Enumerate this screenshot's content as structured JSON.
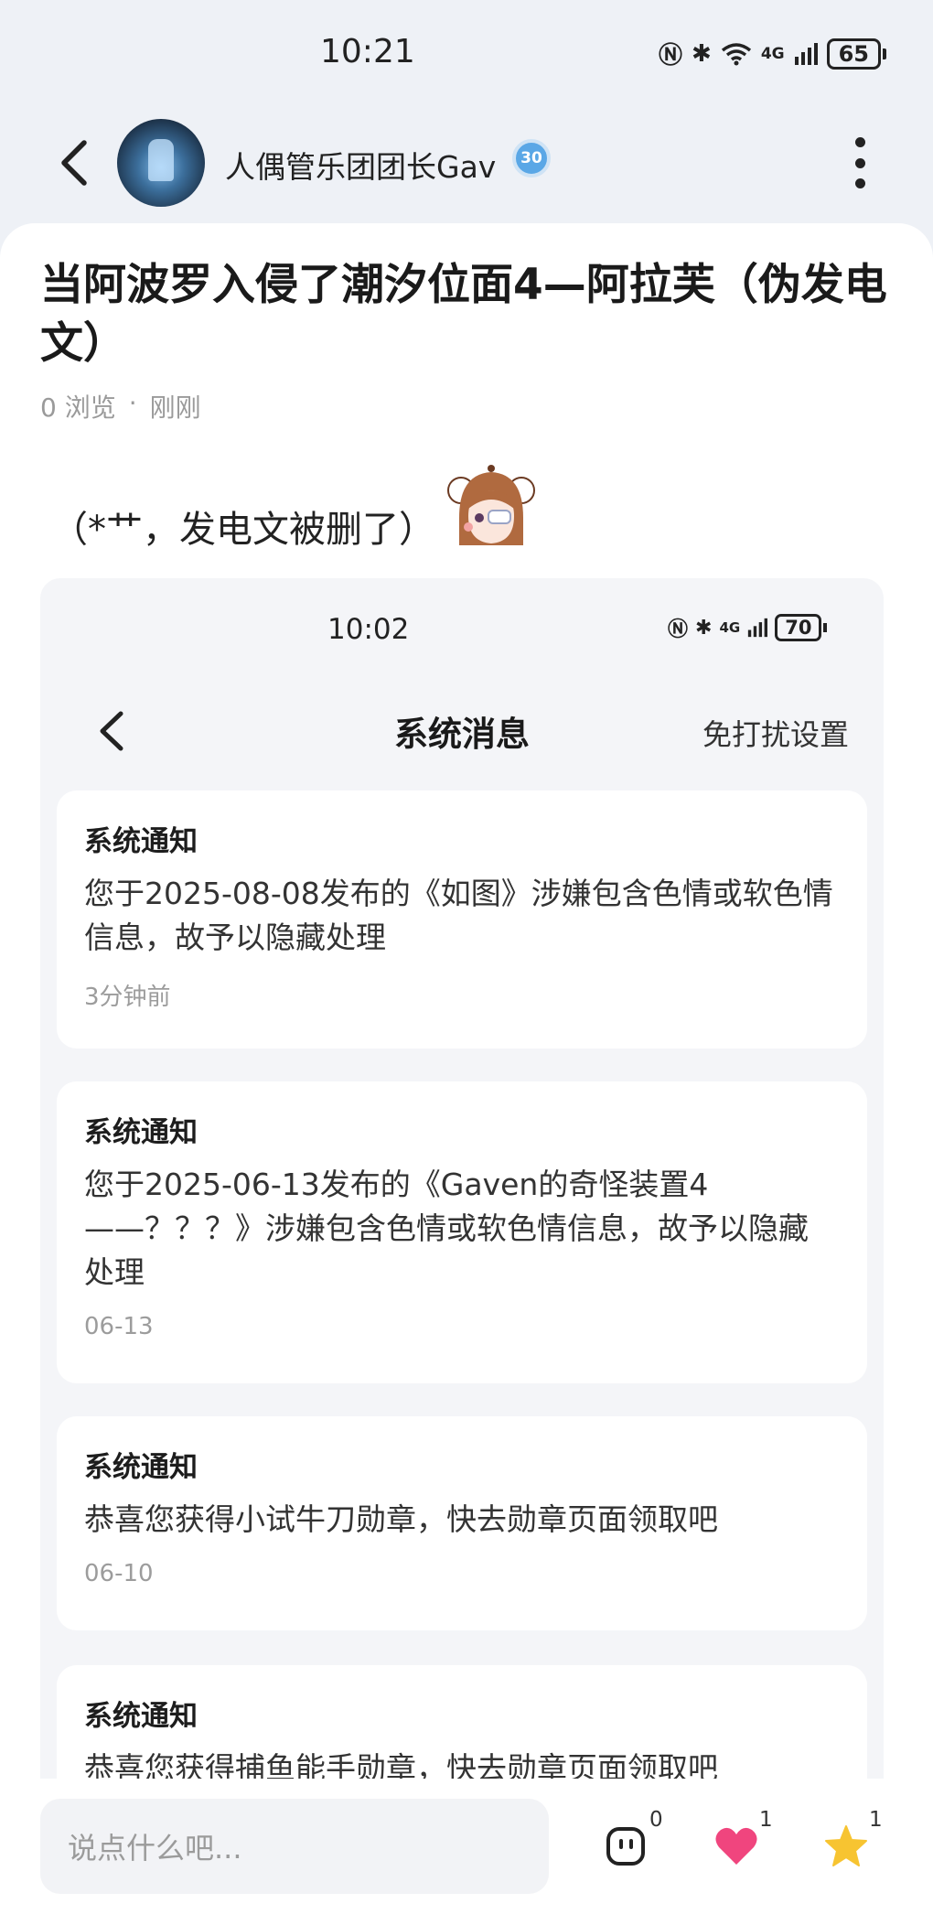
{
  "status_bar": {
    "time": "10:21",
    "network": "4G",
    "battery": "65"
  },
  "header": {
    "author_name": "人偶管乐团团长Gav",
    "level": "30"
  },
  "post": {
    "title": "当阿波罗入侵了潮汐位面4—阿拉芙（伪发电文）",
    "views": "0 浏览",
    "separator": "·",
    "time": "刚刚",
    "text": "（*艹，发电文被删了）"
  },
  "embedded_screenshot": {
    "status_time": "10:02",
    "network": "4G",
    "battery": "70",
    "title": "系统消息",
    "dnd_settings": "免打扰设置",
    "notices": [
      {
        "heading": "系统通知",
        "body": "您于2025-08-08发布的《如图》涉嫌包含色情或软色情信息，故予以隐藏处理",
        "time": "3分钟前"
      },
      {
        "heading": "系统通知",
        "body": "您于2025-06-13发布的《Gaven的奇怪装置4——？？？》涉嫌包含色情或软色情信息，故予以隐藏处理",
        "time": "06-13"
      },
      {
        "heading": "系统通知",
        "body": "恭喜您获得小试牛刀勋章，快去勋章页面领取吧",
        "time": "06-10"
      },
      {
        "heading": "系统通知",
        "body": "恭喜您获得捕鱼能手勋章，快去勋章页面领取吧",
        "time": ""
      }
    ]
  },
  "bottom_bar": {
    "comment_placeholder": "说点什么吧...",
    "comment_count": "0",
    "like_count": "1",
    "favorite_count": "1"
  },
  "colors": {
    "like": "#f0457e",
    "favorite": "#f7c431",
    "level_badge": "#5aa7e6"
  }
}
